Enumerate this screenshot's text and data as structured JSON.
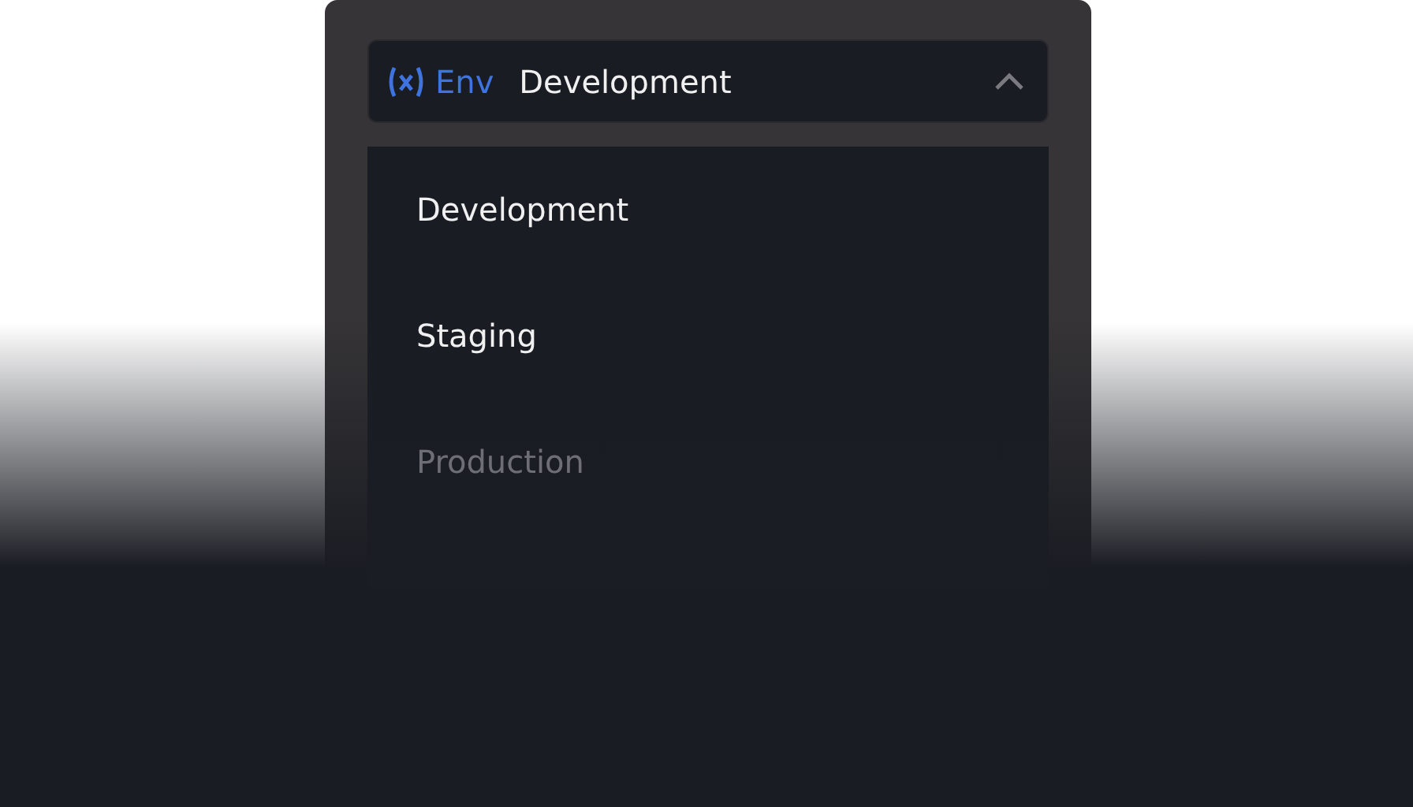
{
  "select": {
    "prefix": "Env",
    "value": "Development",
    "expanded": true
  },
  "options": [
    {
      "label": "Development",
      "disabled": false
    },
    {
      "label": "Staging",
      "disabled": false
    },
    {
      "label": "Production",
      "disabled": true
    }
  ]
}
